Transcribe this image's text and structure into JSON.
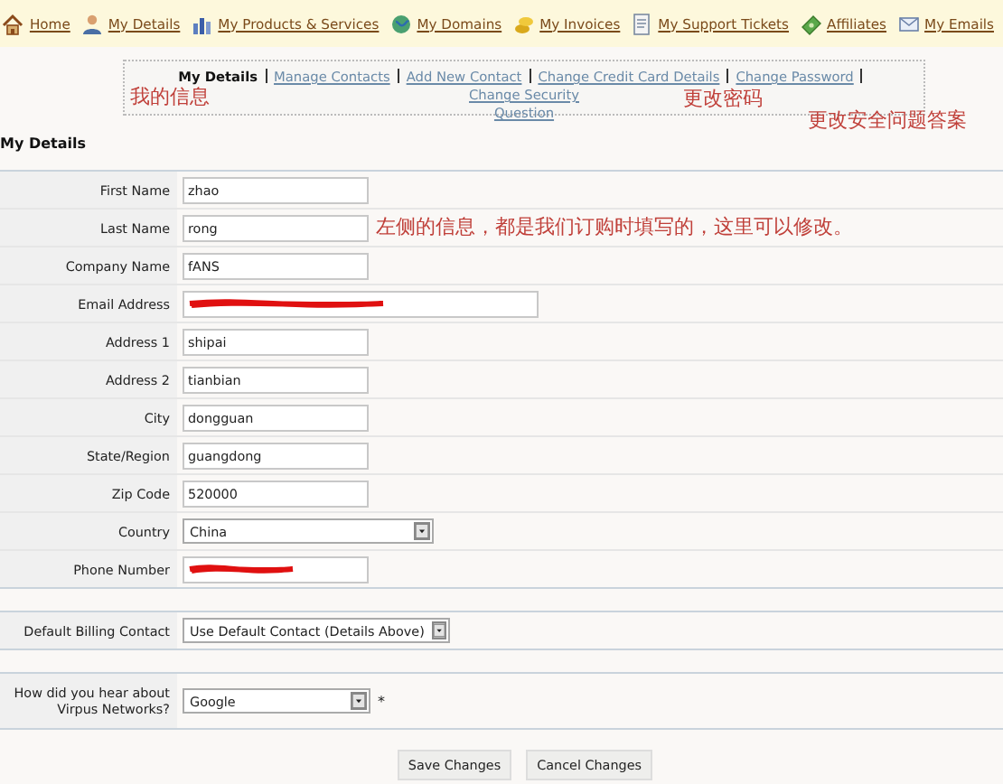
{
  "nav": [
    {
      "label": "Home"
    },
    {
      "label": "My Details"
    },
    {
      "label": "My Products & Services"
    },
    {
      "label": "My Domains"
    },
    {
      "label": "My Invoices"
    },
    {
      "label": "My Support Tickets"
    },
    {
      "label": "Affiliates"
    },
    {
      "label": "My Emails"
    }
  ],
  "subnav": [
    {
      "label": "My Details",
      "selected": true
    },
    {
      "label": "Manage Contacts",
      "selected": false
    },
    {
      "label": "Add New Contact",
      "selected": false
    },
    {
      "label": "Change Credit Card Details",
      "selected": false
    },
    {
      "label": "Change Password",
      "selected": false
    },
    {
      "label": "Change Security Question",
      "selected": false
    }
  ],
  "annotations": [
    {
      "text": "我的信息"
    },
    {
      "text": "更改密码"
    },
    {
      "text": "更改安全问题答案"
    },
    {
      "text": "左侧的信息，都是我们订购时填写的，这里可以修改。"
    }
  ],
  "heading": "My Details",
  "fields": [
    {
      "label": "First Name",
      "kind": "text",
      "value": "zhao"
    },
    {
      "label": "Last Name",
      "kind": "text",
      "value": "rong"
    },
    {
      "label": "Company Name",
      "kind": "text",
      "value": "fANS"
    },
    {
      "label": "Email Address",
      "kind": "redacted",
      "wide": true
    },
    {
      "label": "Address 1",
      "kind": "text",
      "value": "shipai"
    },
    {
      "label": "Address 2",
      "kind": "text",
      "value": "tianbian"
    },
    {
      "label": "City",
      "kind": "text",
      "value": "dongguan"
    },
    {
      "label": "State/Region",
      "kind": "text",
      "value": "guangdong"
    },
    {
      "label": "Zip Code",
      "kind": "text",
      "value": "520000"
    },
    {
      "label": "Country",
      "kind": "select",
      "value": "China"
    },
    {
      "label": "Phone Number",
      "kind": "redacted",
      "wide": false
    }
  ],
  "billing": {
    "label": "Default Billing Contact",
    "value": "Use Default Contact (Details Above)"
  },
  "referral": {
    "label": "How did you hear about Virpus Networks?",
    "value": "Google",
    "required_mark": "*"
  },
  "buttons": [
    {
      "label": "Save Changes"
    },
    {
      "label": "Cancel Changes"
    }
  ]
}
